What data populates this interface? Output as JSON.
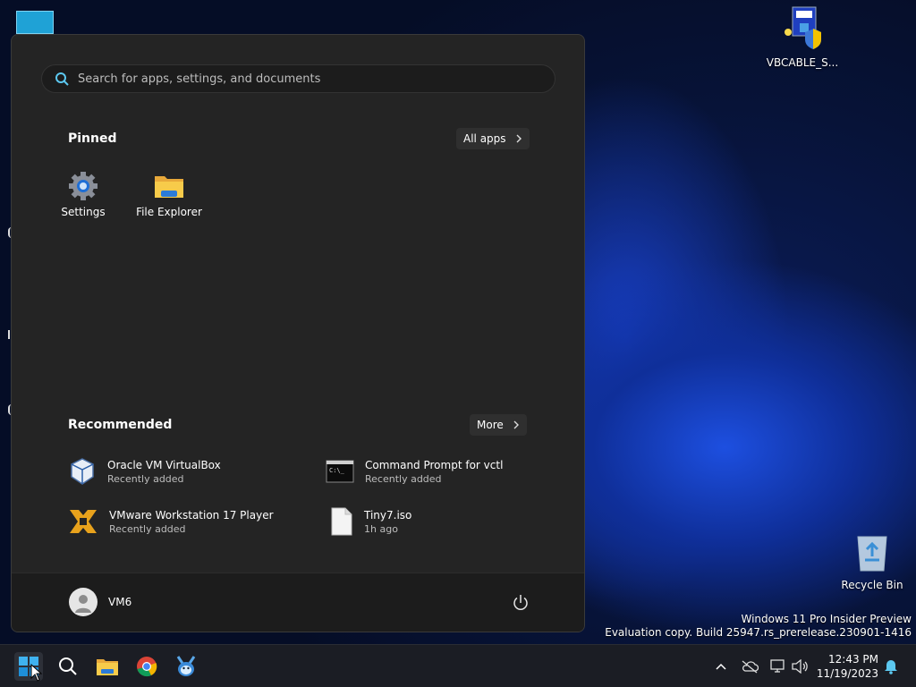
{
  "desktop": {
    "icons": [
      {
        "label": "VBCABLE_S..."
      },
      {
        "label": "Recycle Bin"
      }
    ]
  },
  "start_menu": {
    "search": {
      "placeholder": "Search for apps, settings, and documents"
    },
    "pinned": {
      "title": "Pinned",
      "all_apps_label": "All apps",
      "apps": [
        {
          "label": "Settings",
          "icon": "gear-icon"
        },
        {
          "label": "File Explorer",
          "icon": "folder-icon"
        }
      ]
    },
    "recommended": {
      "title": "Recommended",
      "more_label": "More",
      "items": [
        {
          "name": "Oracle VM VirtualBox",
          "sub": "Recently added",
          "icon": "virtualbox-icon"
        },
        {
          "name": "Command Prompt for vctl",
          "sub": "Recently added",
          "icon": "terminal-icon"
        },
        {
          "name": "VMware Workstation 17 Player",
          "sub": "Recently added",
          "icon": "vmware-icon"
        },
        {
          "name": "Tiny7.iso",
          "sub": "1h ago",
          "icon": "file-icon"
        }
      ]
    },
    "footer": {
      "user_name": "VM6"
    }
  },
  "watermark": {
    "line1": "Windows 11 Pro Insider Preview",
    "line2": "Evaluation copy. Build 25947.rs_prerelease.230901-1416"
  },
  "taskbar": {
    "clock": {
      "time": "12:43 PM",
      "date": "11/19/2023"
    }
  },
  "colors": {
    "accent": "#0078d4",
    "menu_bg": "#242424",
    "taskbar_bg": "#1b1d24"
  }
}
